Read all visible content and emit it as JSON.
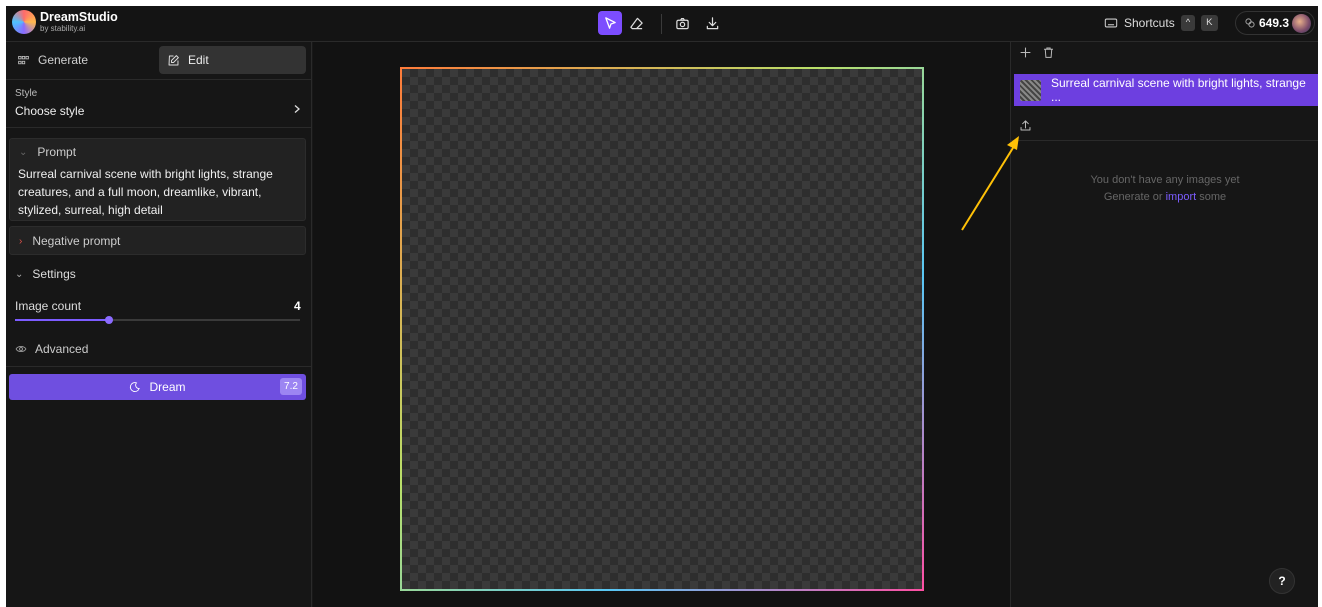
{
  "app": {
    "name": "DreamStudio",
    "subtitle": "by stability.ai"
  },
  "topbar": {
    "tools": [
      "select-tool",
      "eraser-tool",
      "camera-tool",
      "download-tool"
    ],
    "shortcuts_label": "Shortcuts",
    "shortcut_keys": [
      "^",
      "K"
    ],
    "credits": "649.3"
  },
  "left_panel": {
    "tabs": [
      {
        "label": "Generate",
        "active": false
      },
      {
        "label": "Edit",
        "active": true
      }
    ],
    "style": {
      "label": "Style",
      "value": "Choose style"
    },
    "prompt": {
      "label": "Prompt",
      "text": "Surreal carnival scene with bright lights, strange creatures, and a full moon, dreamlike, vibrant, stylized, surreal, high detail"
    },
    "negative_prompt": {
      "label": "Negative prompt"
    },
    "settings": {
      "label": "Settings",
      "image_count_label": "Image count",
      "image_count_value": "4",
      "image_count_fraction": 0.33,
      "advanced_label": "Advanced"
    },
    "dream_button": {
      "label": "Dream",
      "cost": "7.2"
    }
  },
  "right_panel": {
    "layer_label": "Surreal carnival scene with bright lights, strange ...",
    "empty_line1": "You don't have any images yet",
    "empty_line2_prefix": "Generate or ",
    "empty_line2_link": "import",
    "empty_line2_suffix": " some",
    "help_label": "?"
  },
  "colors": {
    "accent": "#7c4dff",
    "layer_bg": "#6d3fe0",
    "annotation_arrow": "#ffc107"
  }
}
